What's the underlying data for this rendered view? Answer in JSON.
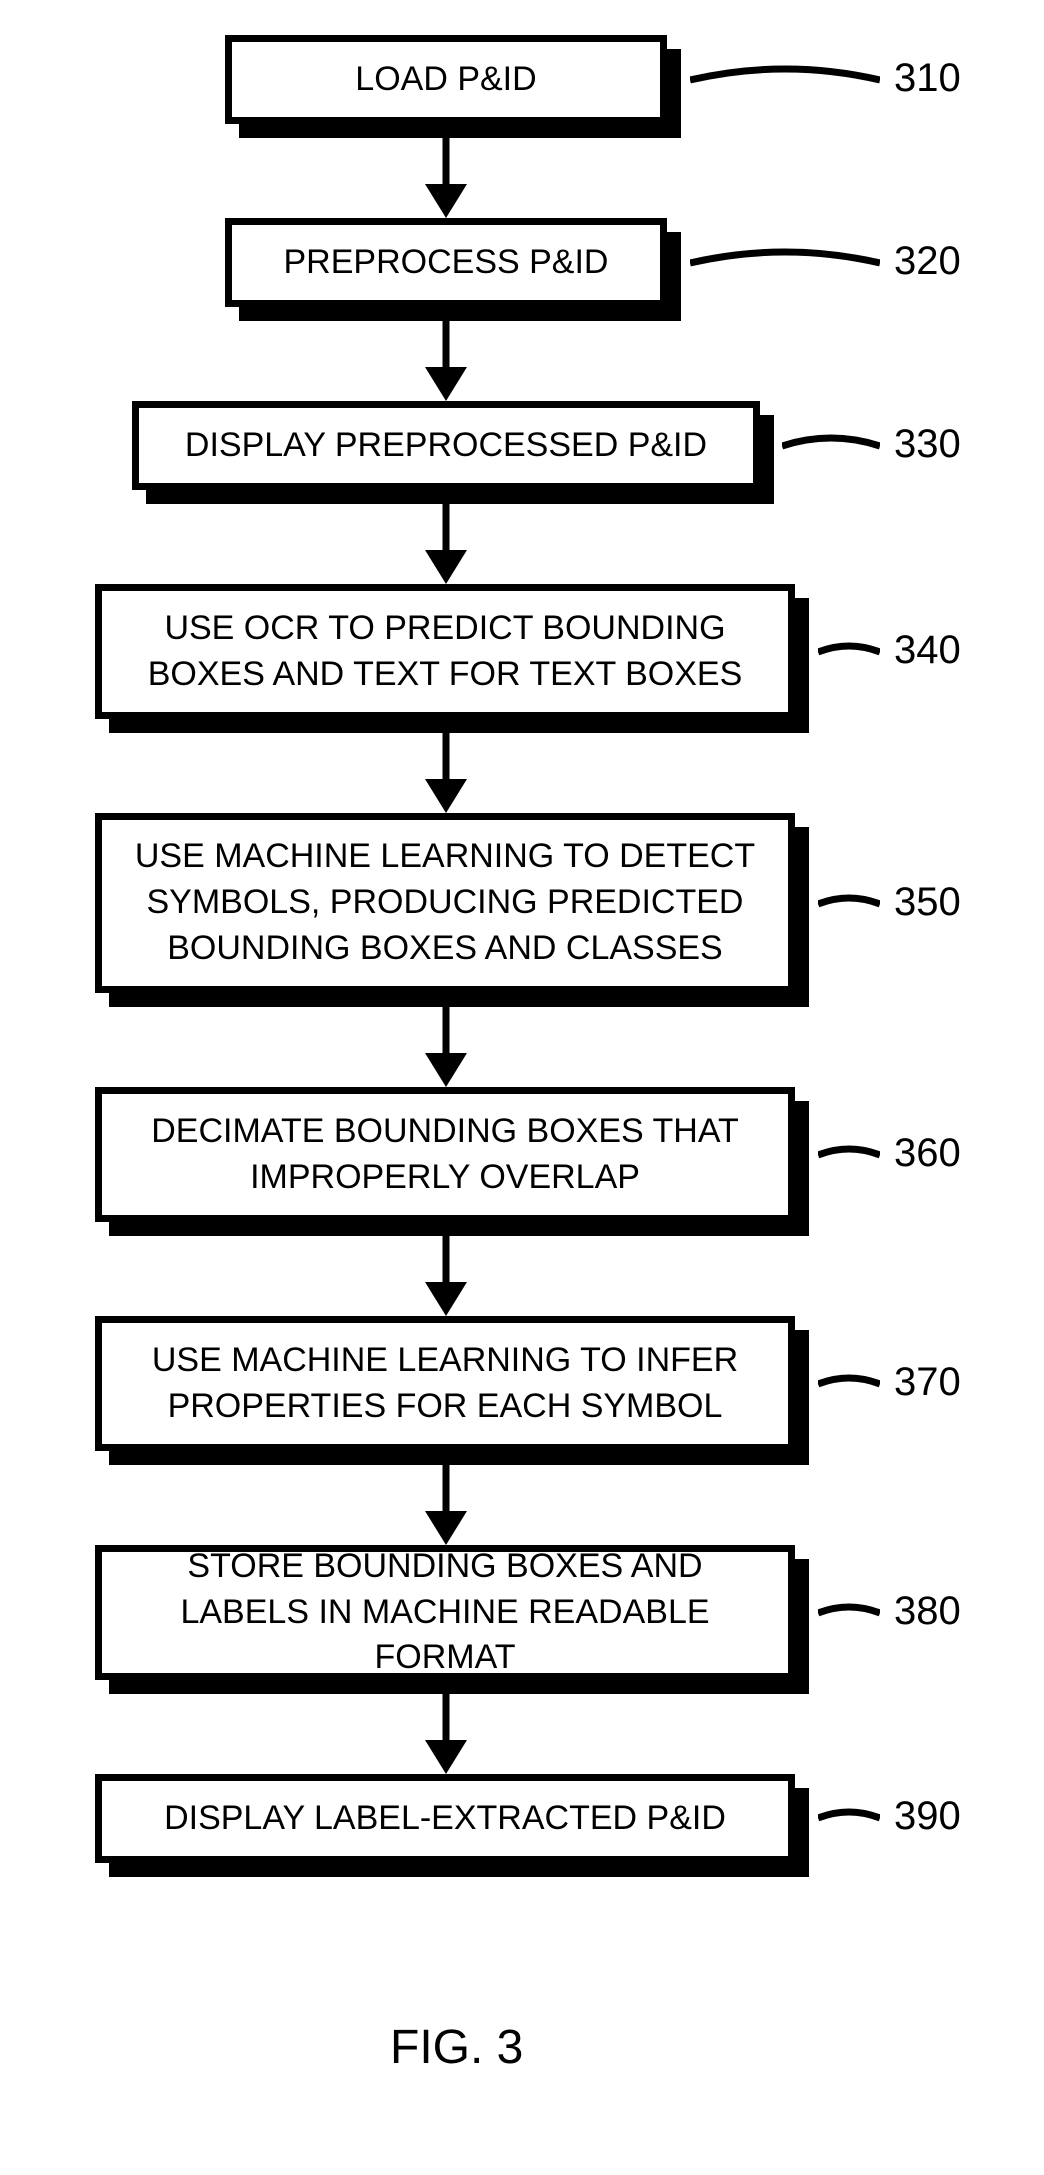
{
  "steps": [
    {
      "id": "310",
      "text": "LOAD P&ID"
    },
    {
      "id": "320",
      "text": "PREPROCESS P&ID"
    },
    {
      "id": "330",
      "text": "DISPLAY PREPROCESSED P&ID"
    },
    {
      "id": "340",
      "text": "USE OCR TO PREDICT BOUNDING BOXES AND TEXT FOR TEXT BOXES"
    },
    {
      "id": "350",
      "text": "USE MACHINE LEARNING TO DETECT SYMBOLS, PRODUCING PREDICTED BOUNDING BOXES AND CLASSES"
    },
    {
      "id": "360",
      "text": "DECIMATE BOUNDING BOXES THAT IMPROPERLY OVERLAP"
    },
    {
      "id": "370",
      "text": "USE MACHINE LEARNING TO INFER PROPERTIES FOR EACH SYMBOL"
    },
    {
      "id": "380",
      "text": "STORE BOUNDING BOXES AND LABELS IN MACHINE READABLE FORMAT"
    },
    {
      "id": "390",
      "text": "DISPLAY LABEL-EXTRACTED P&ID"
    }
  ],
  "caption": "FIG. 3"
}
